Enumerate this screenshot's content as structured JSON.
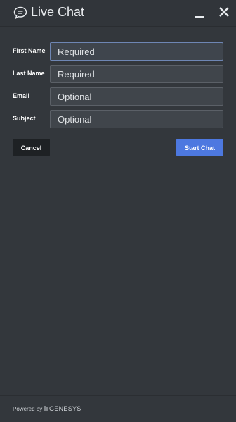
{
  "header": {
    "title": "Live Chat"
  },
  "form": {
    "fields": [
      {
        "label": "First Name",
        "placeholder": "Required"
      },
      {
        "label": "Last Name",
        "placeholder": "Required"
      },
      {
        "label": "Email",
        "placeholder": "Optional"
      },
      {
        "label": "Subject",
        "placeholder": "Optional"
      }
    ],
    "cancel_label": "Cancel",
    "start_label": "Start Chat"
  },
  "footer": {
    "powered_by": "Powered by",
    "brand": "GENESYS"
  },
  "icons": {
    "chat": "chat-bubble-icon",
    "minimize": "minimize-icon",
    "close": "close-icon",
    "brand": "genesys-logo-icon"
  },
  "colors": {
    "background": "#33373c",
    "field_background": "#40454b",
    "primary_button": "#4d78e0",
    "secondary_button": "#1e2124"
  }
}
